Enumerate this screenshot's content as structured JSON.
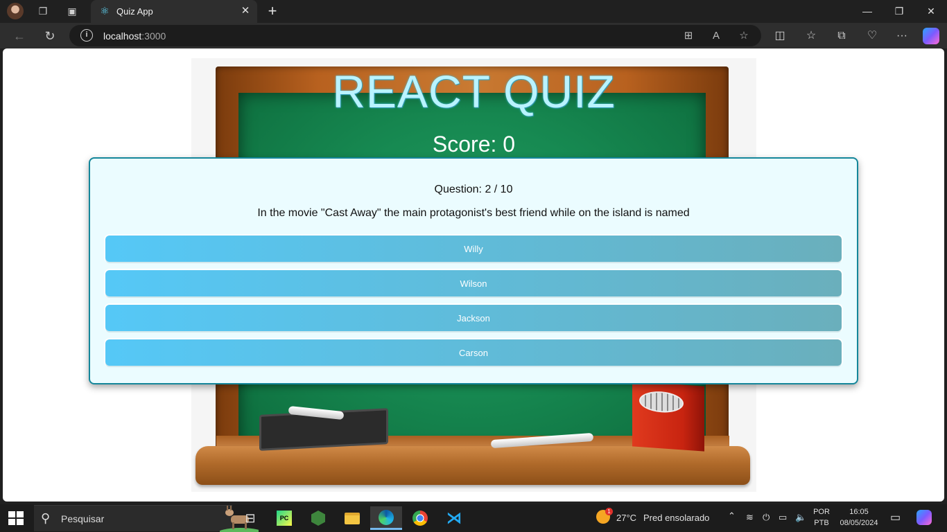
{
  "browser": {
    "tab_title": "Quiz App",
    "url_host": "localhost",
    "url_port": ":3000",
    "icons": {
      "profile": "profile-avatar",
      "workspaces": "workspaces-icon",
      "tab_actions": "tab-actions-icon",
      "tab_favicon": "react-icon",
      "close_tab": "close-icon",
      "new_tab": "plus-icon",
      "back": "back-arrow-icon",
      "refresh": "refresh-icon",
      "site_info": "info-icon",
      "app_available": "app-icon",
      "read_aloud": "read-aloud-icon",
      "favorite": "star-icon",
      "split_screen": "split-screen-icon",
      "favorites": "favorites-icon",
      "collections": "collections-icon",
      "browser_essentials": "heart-pulse-icon",
      "more": "more-icon",
      "copilot": "copilot-icon"
    }
  },
  "quiz": {
    "title": "REACT QUIZ",
    "score_text": "Score: 0",
    "question_count": "Question: 2 / 10",
    "question": "In the movie \"Cast Away\" the main protagonist's best friend while on the island is named",
    "answers": [
      "Willy",
      "Wilson",
      "Jackson",
      "Carson"
    ]
  },
  "taskbar": {
    "search_placeholder": "Pesquisar",
    "weather_temp": "27°C",
    "weather_desc": "Pred ensolarado",
    "weather_alert_count": "1",
    "lang_top": "POR",
    "lang_bottom": "PTB",
    "time": "16:05",
    "date": "08/05/2024"
  },
  "colors": {
    "chalkboard": "#178a52",
    "frame": "#b8611f",
    "title": "#b9f3ff",
    "card_bg": "#ebfcff",
    "card_border": "#14869a",
    "answer_start": "#55c8f7",
    "answer_end": "#6aafbc"
  }
}
